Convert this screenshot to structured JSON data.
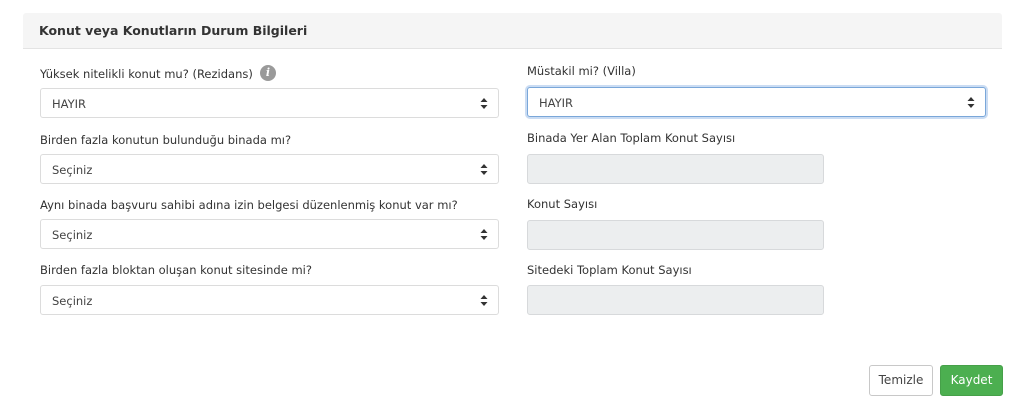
{
  "panel": {
    "title": "Konut veya Konutların Durum Bilgileri"
  },
  "left_fields": [
    {
      "label": "Yüksek nitelikli konut mu? (Rezidans)",
      "value": "HAYIR",
      "has_info": true
    },
    {
      "label": "Birden fazla konutun bulunduğu binada mı?",
      "value": "Seçiniz"
    },
    {
      "label": "Aynı binada başvuru sahibi adına izin belgesi düzenlenmiş konut var mı?",
      "value": "Seçiniz"
    },
    {
      "label": "Birden fazla bloktan oluşan konut sitesinde mi?",
      "value": "Seçiniz"
    }
  ],
  "right_fields": [
    {
      "label": "Müstakil mi? (Villa)",
      "value": "HAYIR",
      "focused": true
    },
    {
      "label": "Binada Yer Alan Toplam Konut Sayısı",
      "value": ""
    },
    {
      "label": "Konut Sayısı",
      "value": ""
    },
    {
      "label": "Sitedeki Toplam Konut Sayısı",
      "value": ""
    }
  ],
  "info_icon_glyph": "i",
  "buttons": {
    "clear_label": "Temizle",
    "save_label": "Kaydet"
  },
  "colors": {
    "save_button": "#4caf50",
    "focus_ring": "#7aa7d9",
    "disabled_field": "#eceeef"
  }
}
